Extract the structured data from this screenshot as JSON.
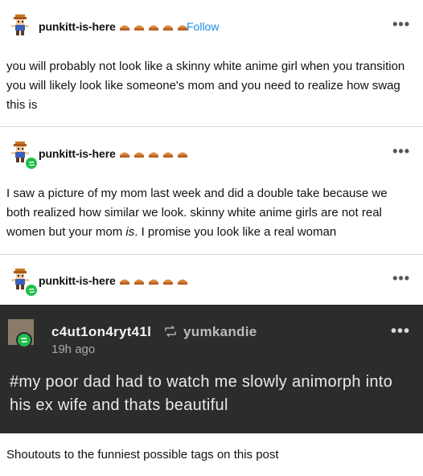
{
  "posts": [
    {
      "username": "punkitt-is-here",
      "follow_label": "Follow",
      "menu": "•••",
      "body": "you will probably not look like a skinny white anime girl when you transition you will likely look like someone's mom and you need to realize how swag this is"
    },
    {
      "username": "punkitt-is-here",
      "menu": "•••",
      "body_before": "I saw a picture of my mom last week and did a double take because we both realized how similar we look. skinny white anime girls are not real women but your mom ",
      "body_emph": "is",
      "body_after": ". I promise you look like a real woman"
    },
    {
      "username": "punkitt-is-here",
      "menu": "•••"
    }
  ],
  "tag_screenshot": {
    "username": "c4ut1on4ryt41l",
    "reblogged_from": "yumkandie",
    "time": "19h ago",
    "menu": "•••",
    "tags": "#my poor dad had to watch me slowly animorph into his ex wife and thats beautiful"
  },
  "caption": "Shoutouts to the funniest possible tags on this post",
  "colors": {
    "follow": "#1c8ce8",
    "badge": "#1fbf4a",
    "dark_bg": "#2c2c2c"
  },
  "icons": {
    "pie": "pie-emoji-icon",
    "reblog": "reblog-icon",
    "badge": "reblog-badge-icon"
  }
}
